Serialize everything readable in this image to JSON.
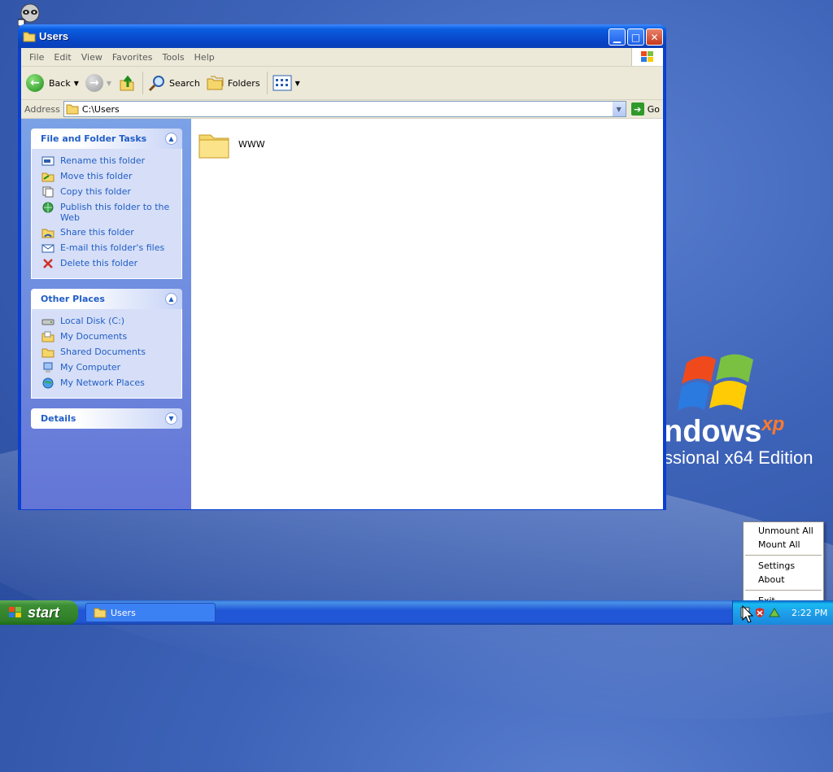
{
  "window": {
    "title": "Users"
  },
  "menubar": {
    "items": [
      "File",
      "Edit",
      "View",
      "Favorites",
      "Tools",
      "Help"
    ]
  },
  "toolbar": {
    "back_label": "Back",
    "search_label": "Search",
    "folders_label": "Folders"
  },
  "address": {
    "label": "Address",
    "value": "C:\\Users",
    "go_label": "Go"
  },
  "tasks_panel": {
    "title": "File and Folder Tasks",
    "items": [
      {
        "label": "Rename this folder",
        "icon": "rename-icon"
      },
      {
        "label": "Move this folder",
        "icon": "move-icon"
      },
      {
        "label": "Copy this folder",
        "icon": "copy-icon"
      },
      {
        "label": "Publish this folder to the Web",
        "icon": "publish-web-icon"
      },
      {
        "label": "Share this folder",
        "icon": "share-icon"
      },
      {
        "label": "E-mail this folder's files",
        "icon": "email-icon"
      },
      {
        "label": "Delete this folder",
        "icon": "delete-icon"
      }
    ]
  },
  "places_panel": {
    "title": "Other Places",
    "items": [
      {
        "label": "Local Disk (C:)",
        "icon": "drive-icon"
      },
      {
        "label": "My Documents",
        "icon": "my-documents-icon"
      },
      {
        "label": "Shared Documents",
        "icon": "folder-icon"
      },
      {
        "label": "My Computer",
        "icon": "computer-icon"
      },
      {
        "label": "My Network Places",
        "icon": "network-icon"
      }
    ]
  },
  "details_panel": {
    "title": "Details"
  },
  "files": [
    {
      "name": "WWW",
      "icon": "folder-icon"
    }
  ],
  "taskbar": {
    "start_label": "start",
    "task_button_label": "Users",
    "clock": "2:22 PM"
  },
  "context_menu": {
    "items": [
      "Unmount All",
      "Mount All",
      "Settings",
      "About",
      "Exit"
    ]
  },
  "wallpaper": {
    "brand_text": "ndows",
    "brand_sup": "xp",
    "edition_text": "ssional x64 Edition"
  },
  "colors": {
    "accent": "#0a3fcf",
    "task_link": "#215dc6",
    "start_green": "#3c8e34"
  }
}
